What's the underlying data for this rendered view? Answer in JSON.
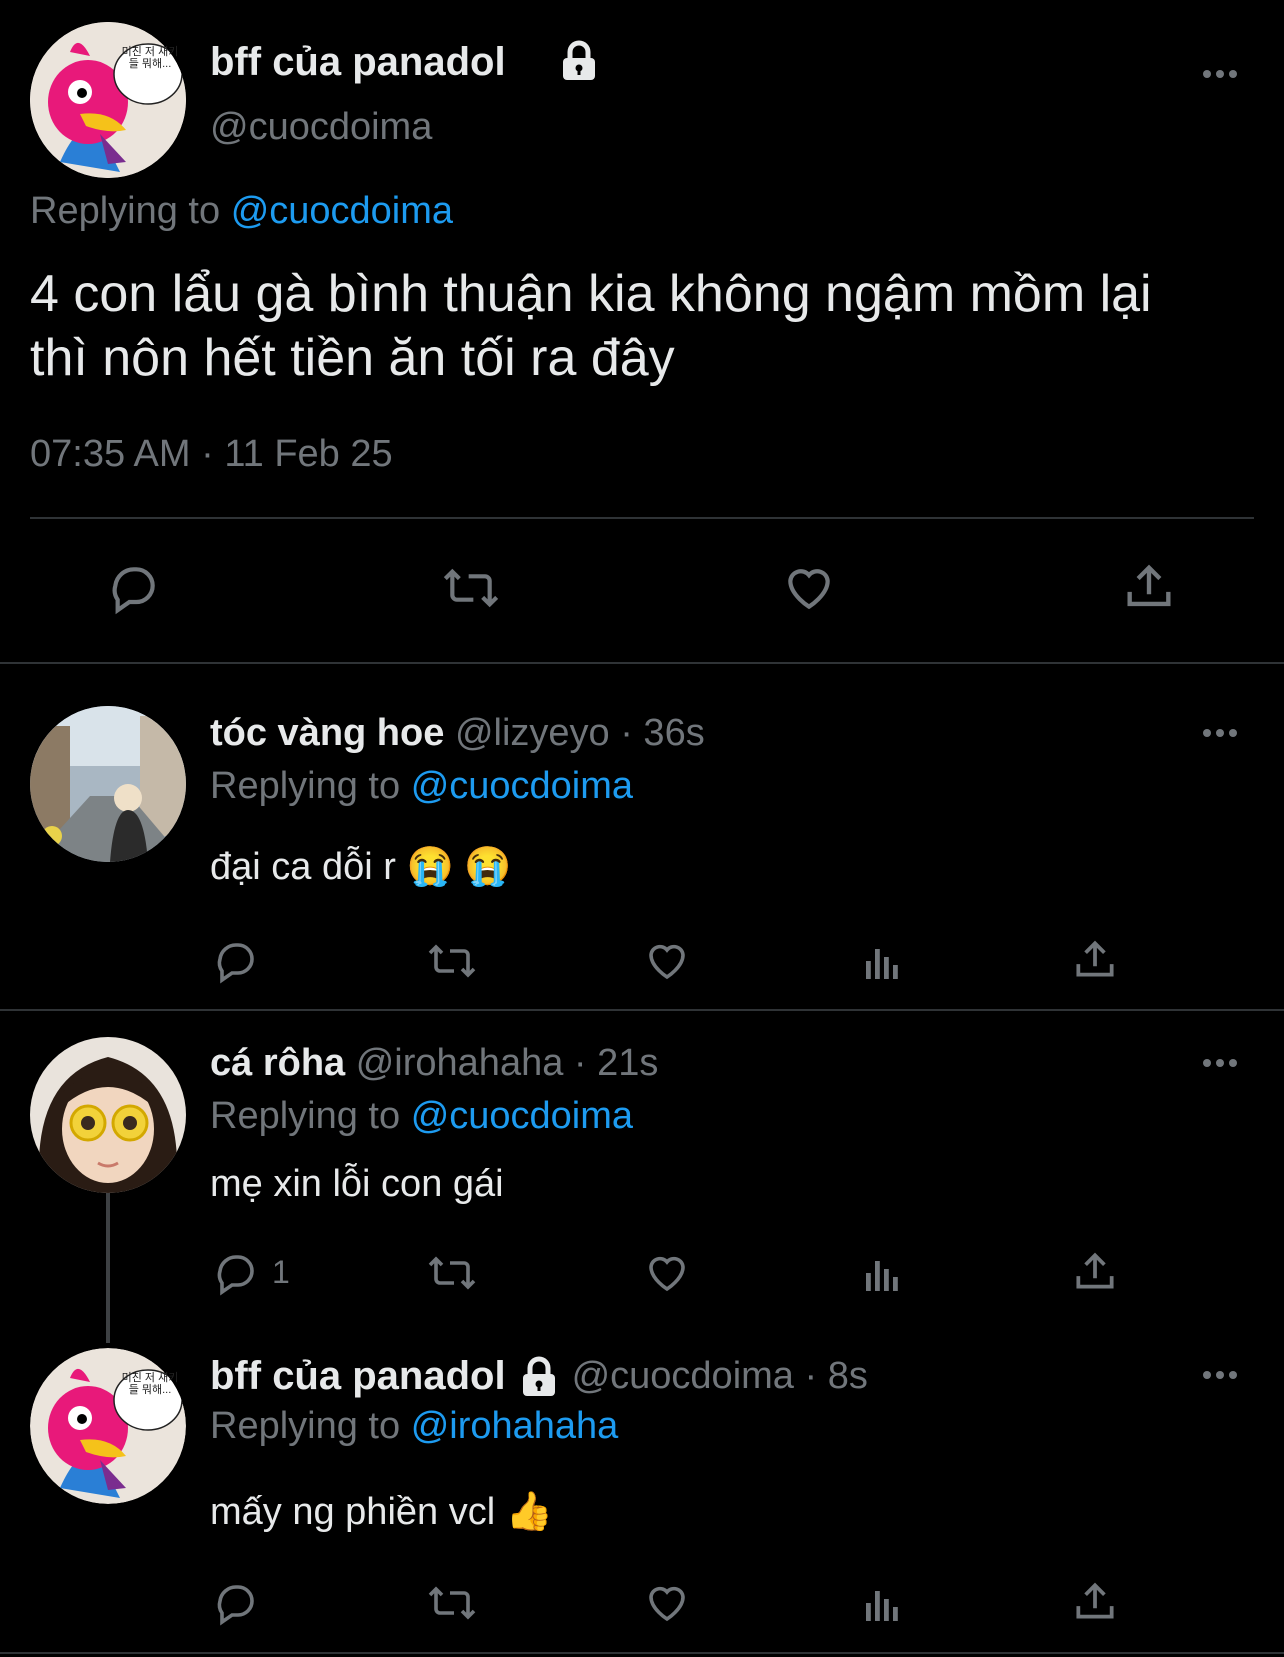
{
  "main_tweet": {
    "name": "bff của panadol",
    "handle": "@cuocdoima",
    "replying_prefix": "Replying to",
    "replying_to": "@cuocdoima",
    "text_line1": "4 con lẩu gà bình thuận kia không ngậm mồm lại",
    "text_line2": "thì nôn hết tiền ăn tối ra đây",
    "timestamp": "07:35 AM · 11 Feb 25",
    "avatar_bubble_text": "미친 저 새키들 뭐해...",
    "actions": [
      "reply-icon",
      "retweet-icon",
      "like-icon",
      "share-icon"
    ]
  },
  "replies": [
    {
      "name": "tóc vàng hoe",
      "handle_time": "@lizyeyo · 36s",
      "replying_prefix": "Replying to",
      "replying_to": "@cuocdoima",
      "text": "đại ca dỗi r 😭 😭",
      "reply_count": ""
    },
    {
      "name": "cá rôha",
      "handle_time": "@irohahaha · 21s",
      "replying_prefix": "Replying to",
      "replying_to": "@cuocdoima",
      "text": "mẹ xin lỗi con gái",
      "reply_count": "1"
    },
    {
      "name": "bff của panadol",
      "handle_time": "@cuocdoima · 8s",
      "replying_prefix": "Replying to",
      "replying_to": "@irohahaha",
      "text": "mấy ng phiền vcl 👍",
      "reply_count": ""
    }
  ],
  "colors": {
    "background": "#000000",
    "text": "#e7e9ea",
    "secondary": "#71767b",
    "link": "#1d9bf0",
    "divider": "#2f3336"
  }
}
